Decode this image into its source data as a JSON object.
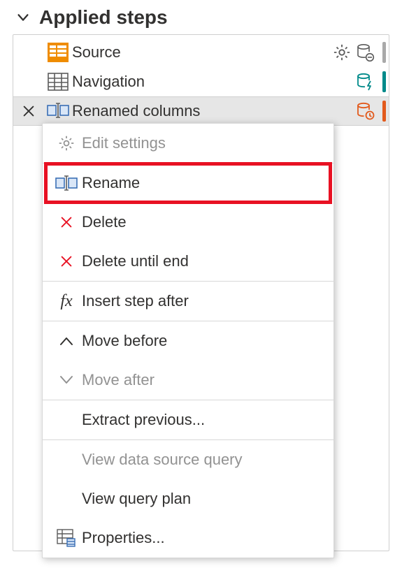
{
  "section": {
    "title": "Applied steps"
  },
  "steps": [
    {
      "label": "Source"
    },
    {
      "label": "Navigation"
    },
    {
      "label": "Renamed columns"
    }
  ],
  "contextMenu": {
    "editSettings": "Edit settings",
    "rename": "Rename",
    "delete": "Delete",
    "deleteUntilEnd": "Delete until end",
    "insertStepAfter": "Insert step after",
    "moveBefore": "Move before",
    "moveAfter": "Move after",
    "extractPrevious": "Extract previous...",
    "viewDataSourceQuery": "View data source query",
    "viewQueryPlan": "View query plan",
    "properties": "Properties..."
  }
}
